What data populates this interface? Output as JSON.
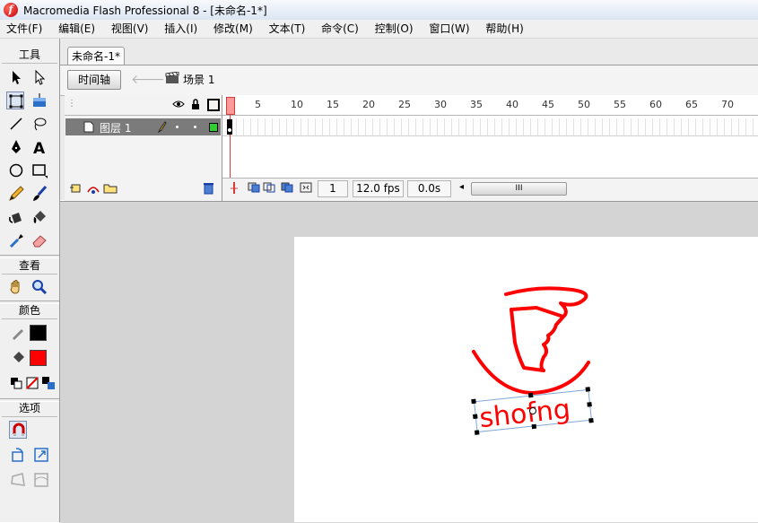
{
  "window": {
    "title": "Macromedia Flash Professional 8 - [未命名-1*]",
    "app_icon_glyph": "f"
  },
  "menu": [
    "文件(F)",
    "编辑(E)",
    "视图(V)",
    "插入(I)",
    "修改(M)",
    "文本(T)",
    "命令(C)",
    "控制(O)",
    "窗口(W)",
    "帮助(H)"
  ],
  "tools": {
    "header_tools": "工具",
    "header_view": "查看",
    "header_colors": "颜色",
    "header_options": "选项",
    "text_tool_glyph": "A"
  },
  "document": {
    "tab_title": "未命名-1*",
    "timeline_button": "时间轴",
    "back_glyph": "🡐",
    "scene_label": "场景 1"
  },
  "timeline": {
    "ticks": [
      "1",
      "5",
      "10",
      "15",
      "20",
      "25",
      "30",
      "35",
      "40",
      "45",
      "50",
      "55",
      "60",
      "65",
      "70"
    ],
    "layer_name": "图层 1",
    "current_frame": "1",
    "frame_rate": "12.0 fps",
    "elapsed_time": "0.0s",
    "scroll_grip": "III",
    "scroll_left_arrow": "◂"
  },
  "stage": {
    "text_object": "shofng",
    "stroke_color": "#ff0000"
  },
  "colors": {
    "stroke_swatch": "#000000",
    "fill_swatch": "#ff0000",
    "layer_color": "#33cc33",
    "playhead": "#ff9a9a"
  }
}
